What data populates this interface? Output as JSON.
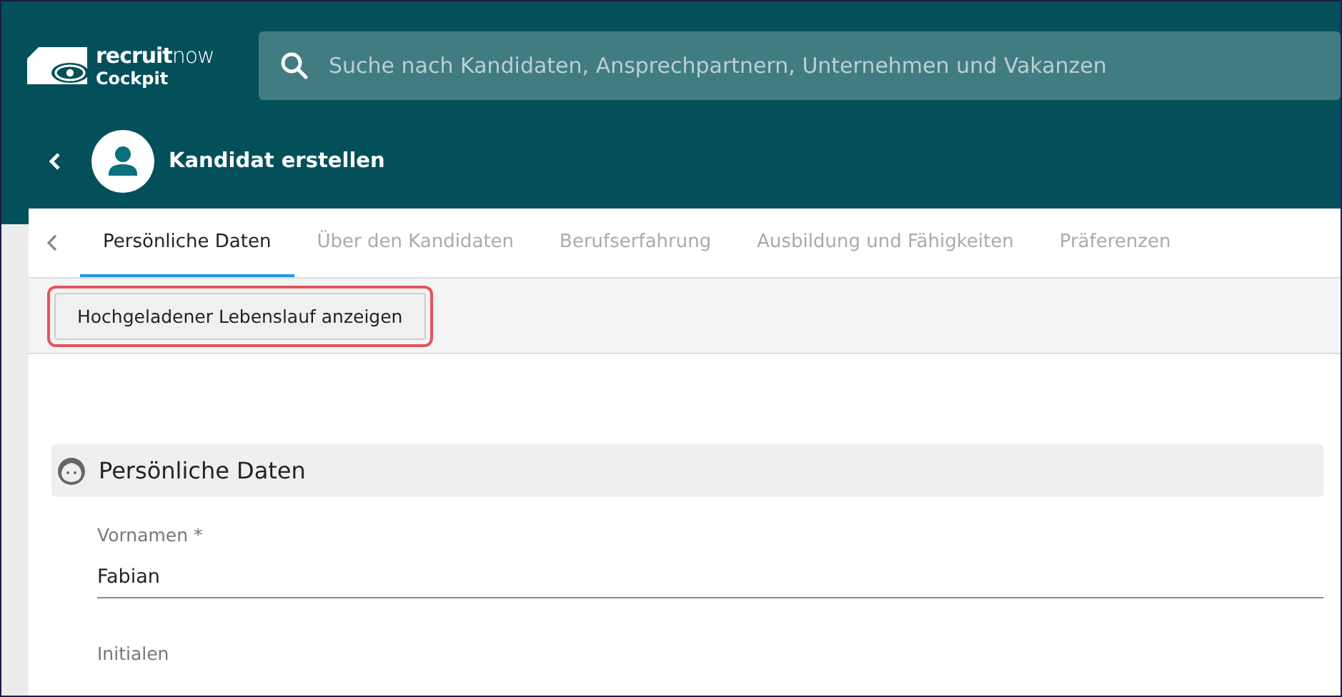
{
  "header": {
    "logo": {
      "brand_bold": "recruit",
      "brand_light": "now",
      "product": "Cockpit"
    },
    "search": {
      "placeholder": "Suche nach Kandidaten, Ansprechpartnern, Unternehmen und Vakanzen"
    }
  },
  "page": {
    "title": "Kandidat erstellen"
  },
  "tabs": [
    {
      "label": "Persönliche Daten",
      "selected": true
    },
    {
      "label": "Über den Kandidaten",
      "selected": false
    },
    {
      "label": "Berufserfahrung",
      "selected": false
    },
    {
      "label": "Ausbildung und Fähigkeiten",
      "selected": false
    },
    {
      "label": "Präferenzen",
      "selected": false
    }
  ],
  "toolbar": {
    "button": {
      "label": "Hochgeladener Lebenslauf anzeigen",
      "highlighted": true
    }
  },
  "section": {
    "title": "Persönliche Daten",
    "fields": [
      {
        "label": "Vornamen *",
        "value": "Fabian"
      },
      {
        "label": "Initialen"
      }
    ]
  }
}
